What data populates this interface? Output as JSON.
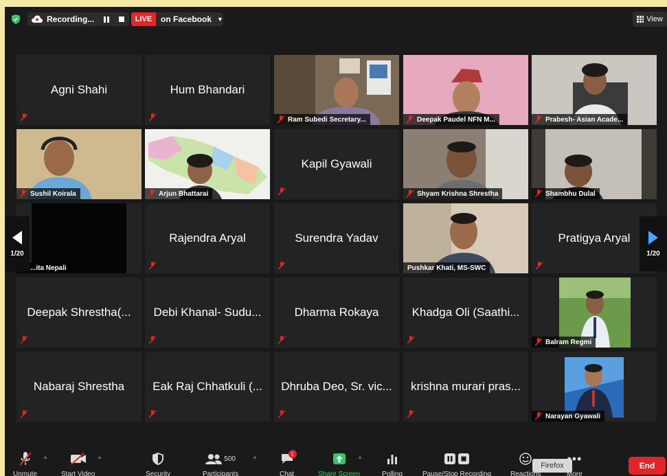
{
  "topbar": {
    "recording_label": "Recording...",
    "live_label": "LIVE",
    "stream_target": "on Facebook",
    "view_label": "View"
  },
  "pagination": {
    "left": "1/20",
    "right": "1/20"
  },
  "tiles": [
    {
      "text": "Agni Shahi",
      "type": "name"
    },
    {
      "text": "Hum Bhandari",
      "type": "name"
    },
    {
      "text": "Ram Subedi Secretary...",
      "type": "video"
    },
    {
      "text": "Deepak Paudel NFN M...",
      "type": "video"
    },
    {
      "text": "Prabesh- Asian Acade...",
      "type": "video"
    },
    {
      "text": "Sushil Koirala",
      "type": "video"
    },
    {
      "text": "Arjun Bhattarai",
      "type": "video"
    },
    {
      "text": "Kapil Gyawali",
      "type": "name"
    },
    {
      "text": "Shyam Krishna Shrestha",
      "type": "video"
    },
    {
      "text": "Shambhu Dulal",
      "type": "video"
    },
    {
      "text": "...ita Nepali",
      "type": "video"
    },
    {
      "text": "Rajendra Aryal",
      "type": "name"
    },
    {
      "text": "Surendra Yadav",
      "type": "name"
    },
    {
      "text": "Pushkar Khati, MS-SWC",
      "type": "video"
    },
    {
      "text": "Pratigya Aryal",
      "type": "name"
    },
    {
      "text": "Deepak Shrestha(...",
      "type": "name"
    },
    {
      "text": "Debi Khanal-  Sudu...",
      "type": "name"
    },
    {
      "text": "Dharma Rokaya",
      "type": "name"
    },
    {
      "text": "Khadga Oli (Saathi...",
      "type": "name"
    },
    {
      "text": "Balram Regmi",
      "type": "video"
    },
    {
      "text": "Nabaraj Shrestha",
      "type": "name"
    },
    {
      "text": "Eak Raj Chhatkuli (...",
      "type": "name"
    },
    {
      "text": "Dhruba Deo, Sr. vic...",
      "type": "name"
    },
    {
      "text": "krishna murari pras...",
      "type": "name"
    },
    {
      "text": "Narayan Gyawali",
      "type": "video"
    }
  ],
  "toolbar": {
    "unmute": "Unmute",
    "start_video": "Start Video",
    "security": "Security",
    "participants": "Participants",
    "participants_count": "500",
    "chat": "Chat",
    "chat_badge": "1",
    "share_screen": "Share Screen",
    "polling": "Polling",
    "recording": "Pause/Stop Recording",
    "reactions": "Reactions",
    "more": "More",
    "end": "End",
    "tooltip": "Firefox"
  },
  "colors": {
    "live": "#e02828",
    "active_speaker": "#cfe46c",
    "share_green": "#38c46b",
    "end_red": "#e0242a"
  }
}
